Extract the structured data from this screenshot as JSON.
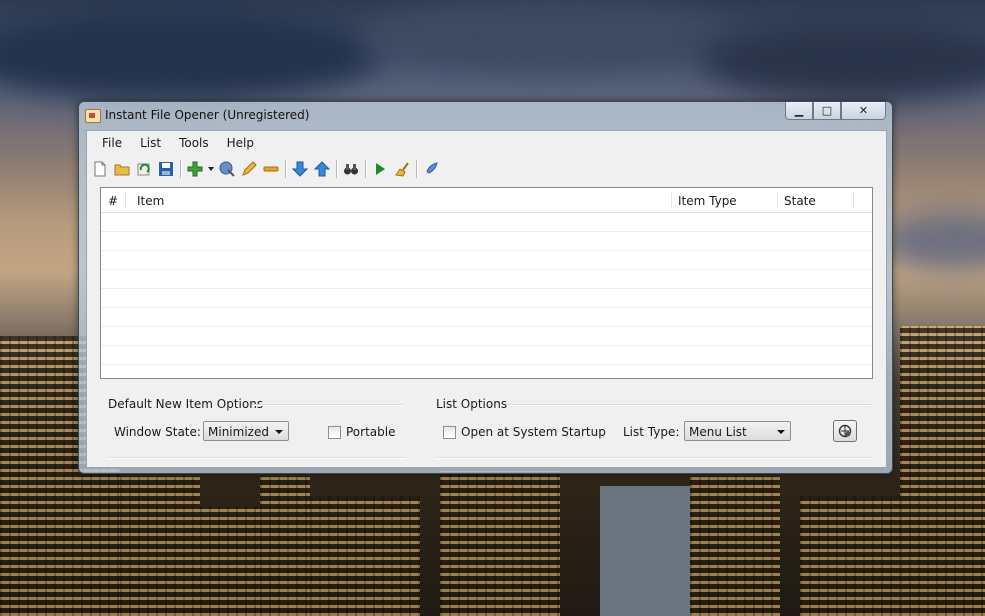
{
  "window": {
    "title": "Instant File Opener (Unregistered)",
    "minimize_glyph": "▁",
    "maximize_glyph": "□",
    "close_glyph": "✕"
  },
  "menu": {
    "items": [
      "File",
      "List",
      "Tools",
      "Help"
    ]
  },
  "toolbar": {
    "icons": [
      "new-list-icon",
      "open-folder-icon",
      "refresh-icon",
      "save-icon",
      "add-item-icon",
      "add-dropdown-arrow-icon",
      "add-web-icon",
      "edit-pencil-icon",
      "remove-item-icon",
      "move-down-icon",
      "move-up-icon",
      "find-binoculars-icon",
      "run-play-icon",
      "clear-broom-icon",
      "launch-rocket-icon"
    ]
  },
  "list": {
    "columns": [
      "#",
      "Item",
      "Item Type",
      "State"
    ],
    "rows": []
  },
  "default_new_item_options": {
    "group_label": "Default New Item Options",
    "window_state_label": "Window State:",
    "window_state_value": "Minimized",
    "portable_label": "Portable",
    "portable_checked": false
  },
  "list_options": {
    "group_label": "List Options",
    "open_at_startup_label": "Open at System Startup",
    "open_at_startup_checked": false,
    "list_type_label": "List Type:",
    "list_type_value": "Menu List"
  },
  "colors": {
    "accent": "#2f7ad6",
    "play_green": "#1d8a2a"
  }
}
